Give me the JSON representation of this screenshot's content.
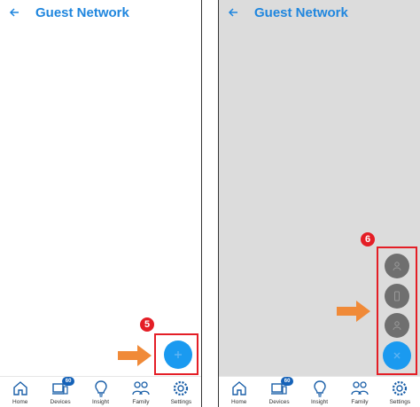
{
  "colors": {
    "accent": "#1f86de",
    "fab": "#1a9af0",
    "fab_sub": "#6f6f6f",
    "highlight": "#e41e26",
    "arrow": "#f08a38",
    "overlay": "#dcdcdc"
  },
  "header": {
    "title": "Guest Network",
    "back_icon": "back-arrow-icon"
  },
  "nav": {
    "items": [
      {
        "label": "Home",
        "icon": "home-icon"
      },
      {
        "label": "Devices",
        "icon": "devices-icon",
        "badge": "60"
      },
      {
        "label": "Insight",
        "icon": "lightbulb-icon"
      },
      {
        "label": "Family",
        "icon": "family-icon"
      },
      {
        "label": "Settings",
        "icon": "gear-icon"
      }
    ]
  },
  "steps": {
    "left": "5",
    "right": "6"
  },
  "fab": {
    "icon": "plus-icon"
  },
  "fab_menu": [
    {
      "icon": "person-icon"
    },
    {
      "icon": "device-icon"
    },
    {
      "icon": "person-icon"
    }
  ]
}
